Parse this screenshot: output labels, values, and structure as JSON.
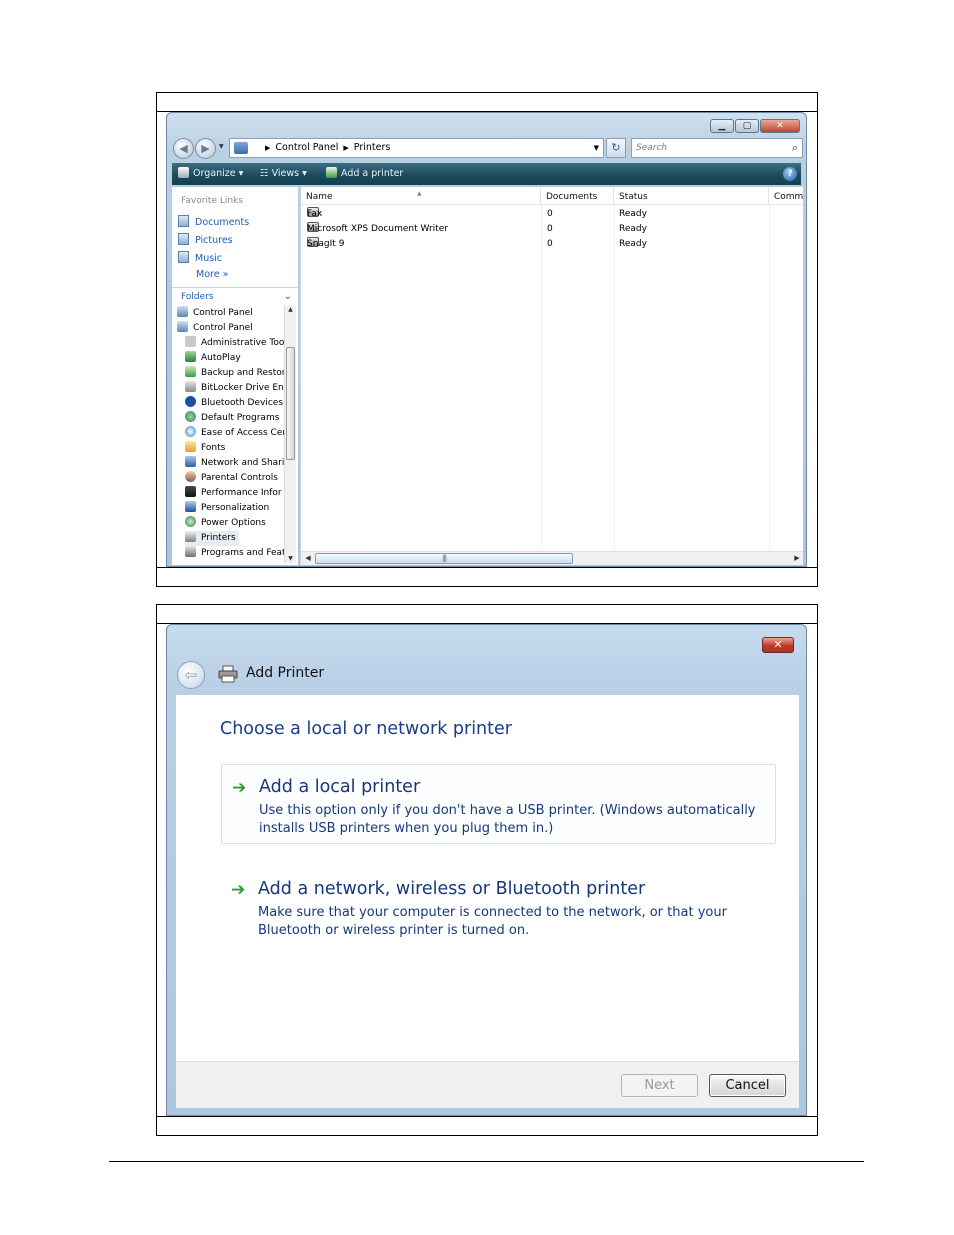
{
  "explorer": {
    "address": {
      "crumbs": [
        "Control Panel",
        "Printers"
      ]
    },
    "search_placeholder": "Search",
    "toolbar": {
      "organize": "Organize",
      "views": "Views",
      "add_printer": "Add a printer"
    },
    "favorite_links": {
      "heading": "Favorite Links",
      "items": [
        "Documents",
        "Pictures",
        "Music"
      ],
      "more": "More"
    },
    "folders_heading": "Folders",
    "tree_items": [
      "Control Panel",
      "Control Panel",
      "Administrative Too",
      "AutoPlay",
      "Backup and Restor",
      "BitLocker Drive En",
      "Bluetooth Devices",
      "Default Programs",
      "Ease of Access Cer",
      "Fonts",
      "Network and Shari",
      "Parental Controls",
      "Performance Infor",
      "Personalization",
      "Power Options",
      "Printers",
      "Programs and Feat"
    ],
    "columns": [
      "Name",
      "Documents",
      "Status",
      "Comm"
    ],
    "printers": [
      {
        "name": "Fax",
        "documents": "0",
        "status": "Ready"
      },
      {
        "name": "Microsoft XPS Document Writer",
        "documents": "0",
        "status": "Ready"
      },
      {
        "name": "SnagIt 9",
        "documents": "0",
        "status": "Ready"
      }
    ]
  },
  "add_printer": {
    "window_title": "Add Printer",
    "heading": "Choose a local or network printer",
    "options": [
      {
        "title": "Add a local printer",
        "description": "Use this option only if you don't have a USB printer. (Windows automatically installs USB printers when you plug them in.)"
      },
      {
        "title": "Add a network, wireless or Bluetooth printer",
        "description": "Make sure that your computer is connected to the network, or that your Bluetooth or wireless printer is turned on."
      }
    ],
    "next_label": "Next",
    "cancel_label": "Cancel"
  }
}
